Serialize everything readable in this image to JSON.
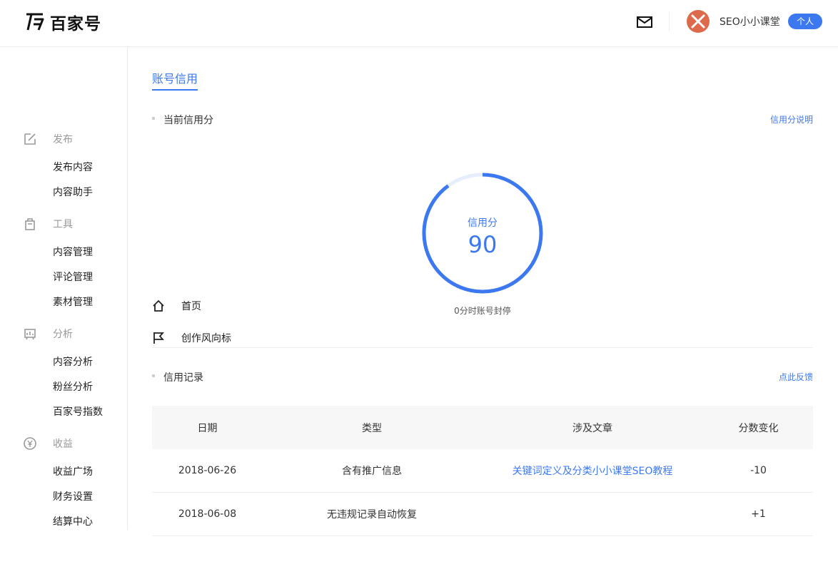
{
  "header": {
    "logo_text": "百家号",
    "username": "SEO小小课堂",
    "account_badge": "个人"
  },
  "sidebar": {
    "items": [
      {
        "label": "首页",
        "kind": "main",
        "icon": "home-icon"
      },
      {
        "label": "创作风向标",
        "kind": "main",
        "icon": "flag-icon"
      },
      {
        "label": "发布",
        "kind": "group",
        "icon": "edit-icon"
      },
      {
        "label": "发布内容",
        "kind": "sub"
      },
      {
        "label": "内容助手",
        "kind": "sub"
      },
      {
        "label": "工具",
        "kind": "group",
        "icon": "bag-icon"
      },
      {
        "label": "内容管理",
        "kind": "sub"
      },
      {
        "label": "评论管理",
        "kind": "sub"
      },
      {
        "label": "素材管理",
        "kind": "sub"
      },
      {
        "label": "分析",
        "kind": "group",
        "icon": "chart-icon"
      },
      {
        "label": "内容分析",
        "kind": "sub"
      },
      {
        "label": "粉丝分析",
        "kind": "sub"
      },
      {
        "label": "百家号指数",
        "kind": "sub"
      },
      {
        "label": "收益",
        "kind": "group",
        "icon": "yen-icon"
      },
      {
        "label": "收益广场",
        "kind": "sub"
      },
      {
        "label": "财务设置",
        "kind": "sub"
      },
      {
        "label": "结算中心",
        "kind": "sub"
      }
    ]
  },
  "main": {
    "tab_label": "账号信用",
    "current_section": {
      "title": "当前信用分",
      "help_link": "信用分说明",
      "score_label": "信用分",
      "score": "90",
      "score_fraction": 0.9,
      "note": "0分时账号封停"
    },
    "records_section": {
      "title": "信用记录",
      "feedback_link": "点此反馈",
      "columns": [
        "日期",
        "类型",
        "涉及文章",
        "分数变化"
      ],
      "rows": [
        {
          "date": "2018-06-26",
          "type": "含有推广信息",
          "article": "关键词定义及分类小小课堂SEO教程",
          "change": "-10"
        },
        {
          "date": "2018-06-08",
          "type": "无违规记录自动恢复",
          "article": "",
          "change": "+1"
        }
      ]
    }
  },
  "colors": {
    "accent": "#3c79f0",
    "gauge_track": "#e6eefc"
  }
}
